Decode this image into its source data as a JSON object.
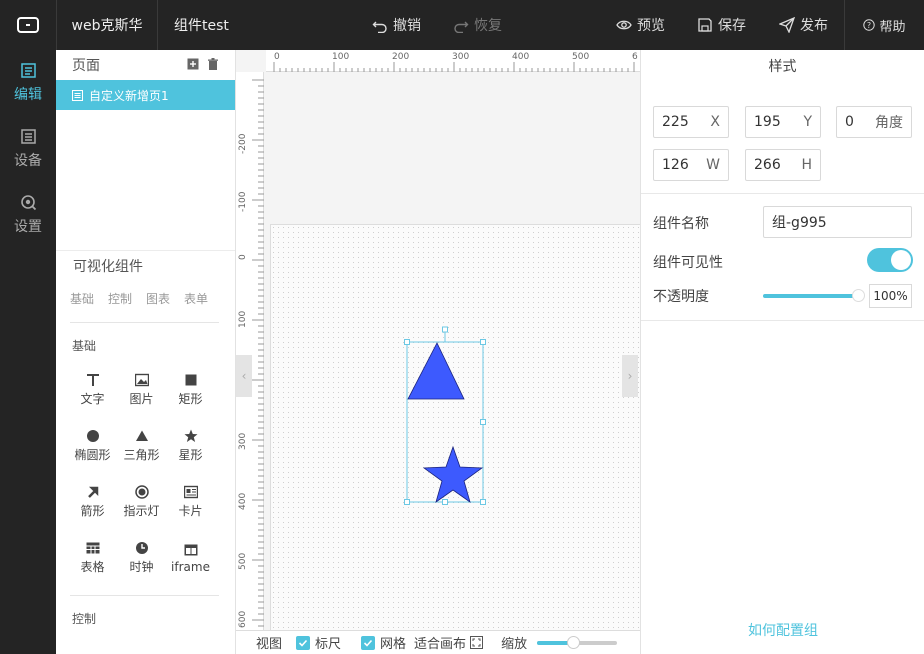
{
  "topbar": {
    "project_name": "web克斯华",
    "component_name": "组件test",
    "undo": "撤销",
    "redo": "恢复",
    "preview": "预览",
    "save": "保存",
    "publish": "发布",
    "help": "帮助"
  },
  "leftnav": [
    {
      "label": "编辑",
      "icon": "edit-icon"
    },
    {
      "label": "设备",
      "icon": "device-icon"
    },
    {
      "label": "设置",
      "icon": "settings-icon"
    }
  ],
  "pages": {
    "title": "页面",
    "items": [
      "自定义新增页1"
    ]
  },
  "components": {
    "title": "可视化组件",
    "tabs": [
      "基础",
      "控制",
      "图表",
      "表单"
    ],
    "section_basic": "基础",
    "basic_items": [
      "文字",
      "图片",
      "矩形",
      "椭圆形",
      "三角形",
      "星形",
      "箭形",
      "指示灯",
      "卡片",
      "表格",
      "时钟",
      "iframe"
    ],
    "section_control": "控制"
  },
  "ruler": {
    "top": [
      "0",
      "100",
      "200",
      "300",
      "400",
      "500",
      "6"
    ],
    "left": [
      "-200",
      "-100",
      "0",
      "100",
      "200",
      "300",
      "400",
      "500",
      "600"
    ]
  },
  "bottombar": {
    "view": "视图",
    "ruler": "标尺",
    "grid": "网格",
    "fit": "适合画布",
    "zoom": "缩放"
  },
  "style_panel": {
    "title": "样式",
    "x": "225",
    "x_label": "X",
    "y": "195",
    "y_label": "Y",
    "angle": "0",
    "angle_label": "角度",
    "w": "126",
    "w_label": "W",
    "h": "266",
    "h_label": "H",
    "name_label": "组件名称",
    "name_value": "组-g995",
    "visible_label": "组件可见性",
    "opacity_label": "不透明度",
    "opacity_value": "100%",
    "help_link": "如何配置组"
  },
  "colors": {
    "accent": "#4fc3dd",
    "shape_fill": "#3d5afe",
    "dark": "#242424"
  }
}
